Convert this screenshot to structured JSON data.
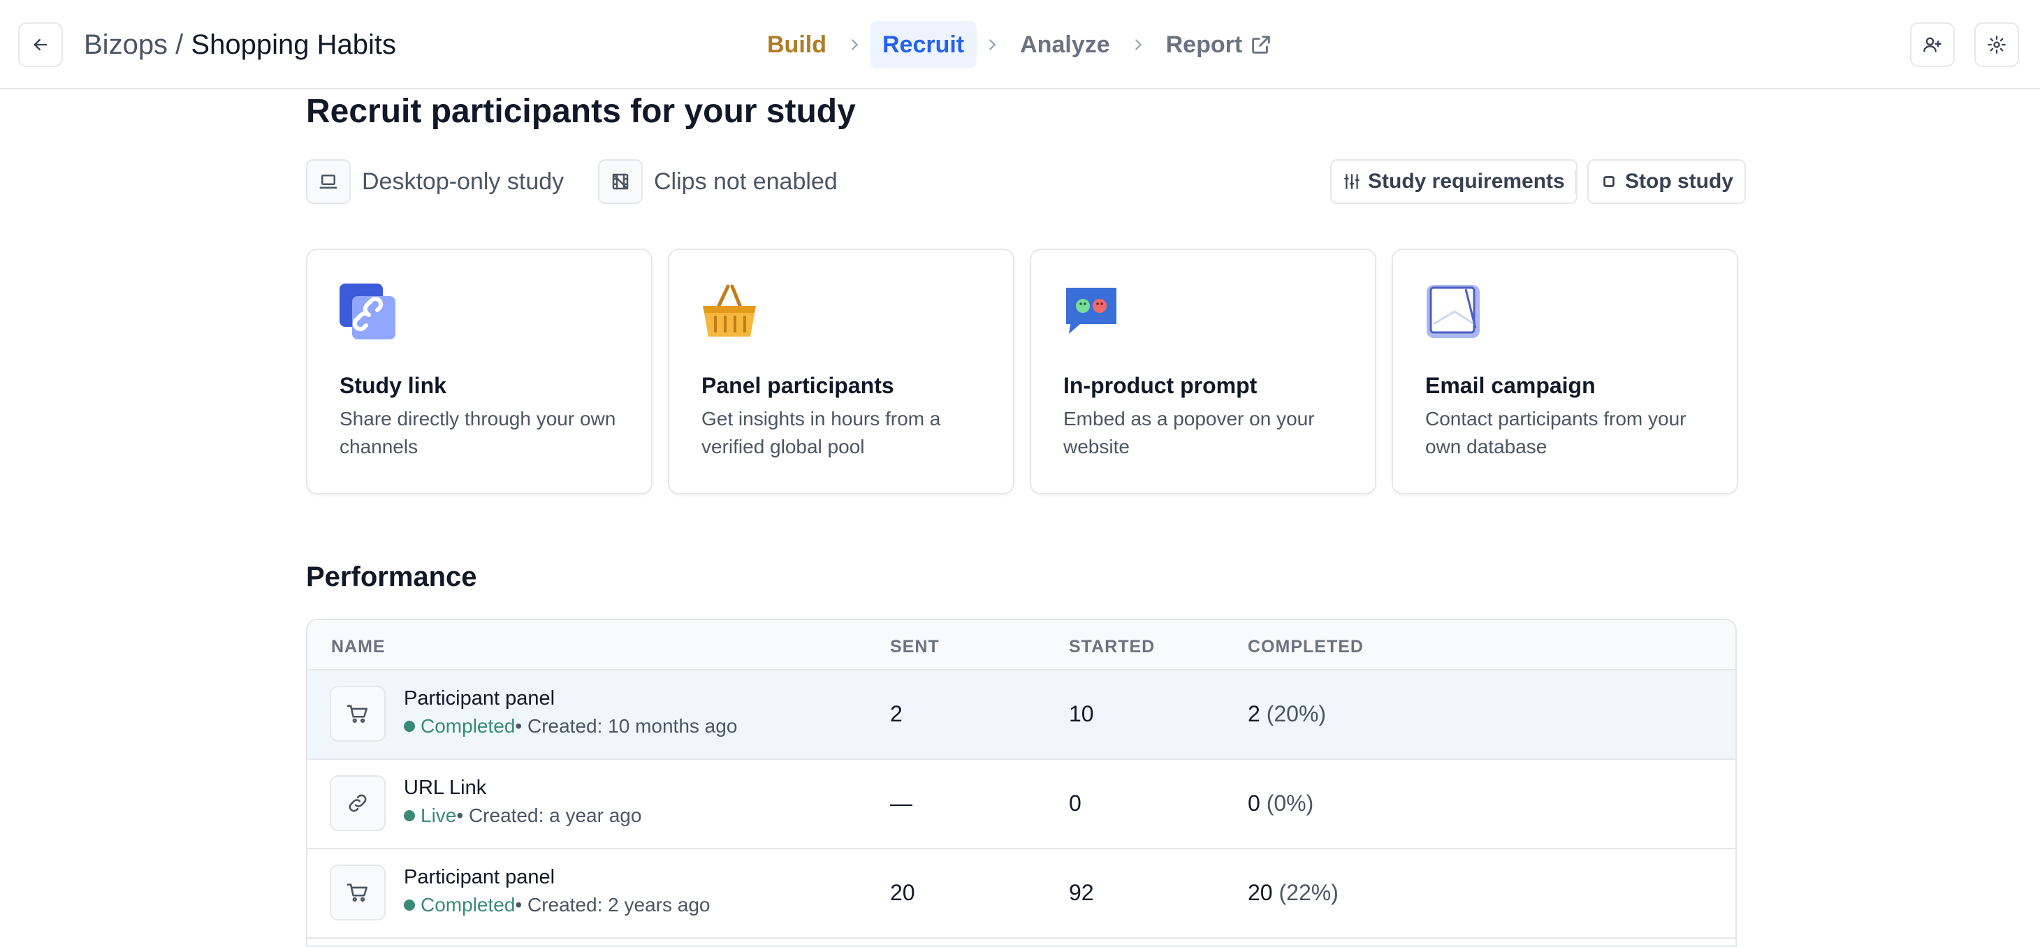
{
  "header": {
    "back_icon": "arrow-left-icon",
    "org": "Bizops",
    "separator": " / ",
    "study": "Shopping Habits",
    "steps": [
      {
        "label": "Build",
        "state": "done"
      },
      {
        "label": "Recruit",
        "state": "active"
      },
      {
        "label": "Analyze",
        "state": "pending"
      },
      {
        "label": "Report",
        "state": "pending"
      }
    ],
    "report_icon": "external-link-icon",
    "invite_icon": "user-plus-icon",
    "settings_icon": "gear-icon"
  },
  "page": {
    "title": "Recruit participants for your study",
    "attributes": [
      {
        "label": "Desktop-only study",
        "icon": "laptop-icon"
      },
      {
        "label": "Clips not enabled",
        "icon": "film-off-icon"
      }
    ],
    "buttons": {
      "requirements": "Study requirements",
      "stop": "Stop study"
    }
  },
  "channels": [
    {
      "title": "Study link",
      "desc": "Share directly through your own channels",
      "icon": "link-illustration-icon"
    },
    {
      "title": "Panel participants",
      "desc": "Get insights in hours from a verified global pool",
      "icon": "basket-illustration-icon"
    },
    {
      "title": "In-product prompt",
      "desc": "Embed as a popover on your website",
      "icon": "chat-bubble-illustration-icon"
    },
    {
      "title": "Email campaign",
      "desc": "Contact participants from your own database",
      "icon": "envelope-illustration-icon"
    }
  ],
  "performance": {
    "title": "Performance",
    "columns": {
      "name": "NAME",
      "sent": "SENT",
      "started": "STARTED",
      "completed": "COMPLETED"
    },
    "rows": [
      {
        "name": "Participant panel",
        "status": "Completed",
        "created": " • Created: 10 months ago",
        "sent": "2",
        "started": "10",
        "completed": "2",
        "pct": " (20%)",
        "icon": "cart-icon"
      },
      {
        "name": "URL Link",
        "status": "Live",
        "created": " • Created: a year ago",
        "sent": "—",
        "started": "0",
        "completed": "0",
        "pct": " (0%)",
        "icon": "link-icon"
      },
      {
        "name": "Participant panel",
        "status": "Completed",
        "created": " • Created: 2 years ago",
        "sent": "20",
        "started": "92",
        "completed": "20",
        "pct": " (22%)",
        "icon": "cart-icon"
      }
    ]
  },
  "colors": {
    "accent": "#2563eb",
    "build_step": "#b07b24",
    "status_green": "#3a8a7a",
    "row_highlight": "#f0f7fc"
  }
}
